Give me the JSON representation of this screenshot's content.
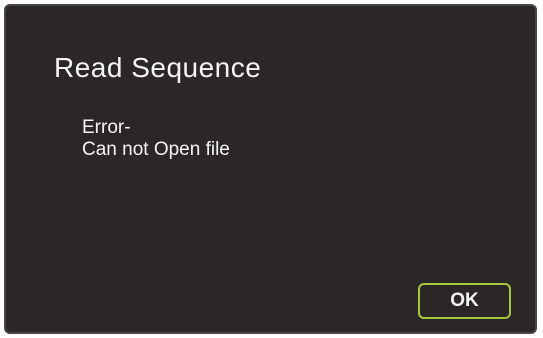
{
  "dialog": {
    "title": "Read Sequence",
    "message_lines": [
      "Error-",
      "Can not Open file"
    ],
    "ok_label": "OK"
  },
  "colors": {
    "background": "#2b2726",
    "border": "#4a4544",
    "text": "#f4f4f4",
    "ok_button_border": "#a6c63b"
  }
}
